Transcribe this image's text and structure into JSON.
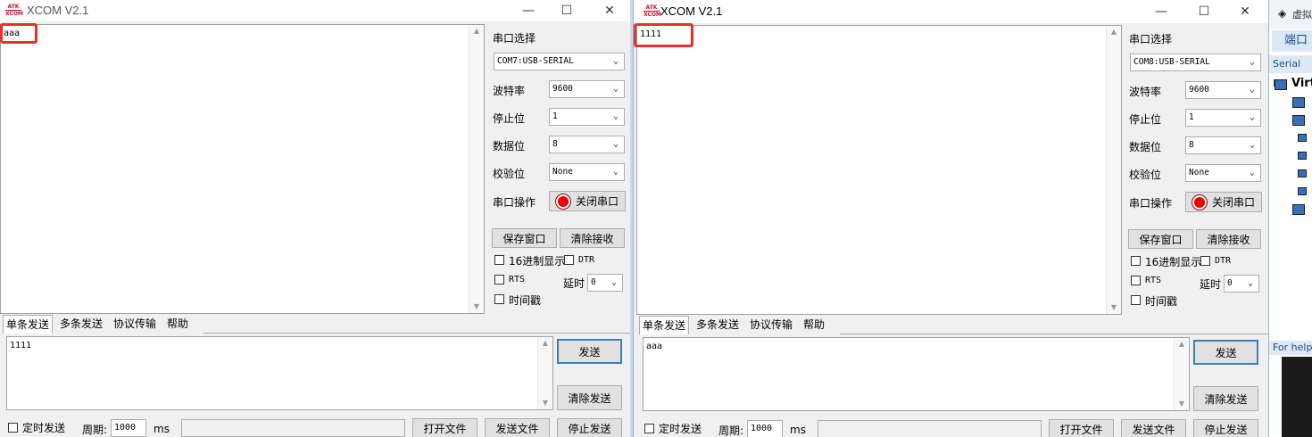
{
  "left": {
    "title": "XCOM V2.1",
    "receive_text": "aaa",
    "labels": {
      "port_select": "串口选择",
      "baud": "波特率",
      "stop_bits": "停止位",
      "data_bits": "数据位",
      "parity": "校验位",
      "port_op": "串口操作"
    },
    "port_value": "COM7:USB-SERIAL",
    "baud_value": "9600",
    "stop_value": "1",
    "data_value": "8",
    "parity_value": "None",
    "close_port": "关闭串口",
    "save_window": "保存窗口",
    "clear_receive": "清除接收",
    "hex_display": "16进制显示",
    "dtr": "DTR",
    "rts": "RTS",
    "delay_label": "延时",
    "delay_value": "0",
    "timestamp": "时间戳",
    "tabs": [
      "单条发送",
      "多条发送",
      "协议传输",
      "帮助"
    ],
    "send_text": "1111",
    "send_btn": "发送",
    "clear_send": "清除发送",
    "timed_send": "定时发送",
    "period_label": "周期:",
    "period_value": "1000",
    "ms": "ms",
    "open_file": "打开文件",
    "send_file": "发送文件",
    "stop_send": "停止发送"
  },
  "right": {
    "title": "XCOM V2.1",
    "receive_text": "1111",
    "labels": {
      "port_select": "串口选择",
      "baud": "波特率",
      "stop_bits": "停止位",
      "data_bits": "数据位",
      "parity": "校验位",
      "port_op": "串口操作"
    },
    "port_value": "COM8:USB-SERIAL",
    "baud_value": "9600",
    "stop_value": "1",
    "data_value": "8",
    "parity_value": "None",
    "close_port": "关闭串口",
    "save_window": "保存窗口",
    "clear_receive": "清除接收",
    "hex_display": "16进制显示",
    "dtr": "DTR",
    "rts": "RTS",
    "delay_label": "延时",
    "delay_value": "0",
    "timestamp": "时间戳",
    "tabs": [
      "单条发送",
      "多条发送",
      "协议传输",
      "帮助"
    ],
    "send_text": "aaa",
    "send_btn": "发送",
    "clear_send": "清除发送",
    "timed_send": "定时发送",
    "period_label": "周期:",
    "period_value": "1000",
    "ms": "ms",
    "open_file": "打开文件",
    "send_file": "发送文件",
    "stop_send": "停止发送"
  },
  "background": {
    "title_partial": "虚拟",
    "tab_partial": "端口",
    "strip_partial": "Serial po",
    "node_partial": "Virt",
    "help_partial": "For help"
  },
  "colors": {
    "highlight": "#e8312a",
    "led": "#ee0000"
  }
}
